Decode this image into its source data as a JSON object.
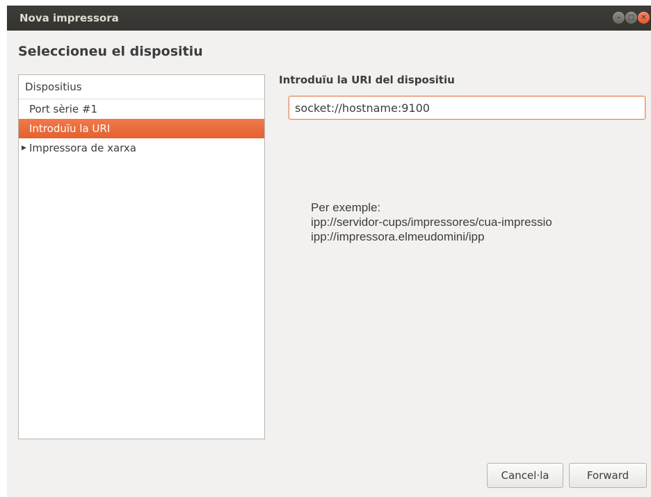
{
  "window": {
    "title": "Nova impressora"
  },
  "heading": "Seleccioneu el dispositiu",
  "devices": {
    "header": "Dispositius",
    "items": [
      {
        "label": "Port sèrie #1",
        "selected": false,
        "expandable": false
      },
      {
        "label": "Introduïu la URI",
        "selected": true,
        "expandable": false
      },
      {
        "label": "Impressora de xarxa",
        "selected": false,
        "expandable": true
      }
    ]
  },
  "uri": {
    "label": "Introduïu la URI del dispositiu",
    "value": "socket://hostname:9100"
  },
  "example": {
    "title": "Per exemple:",
    "line1": "ipp://servidor-cups/impressores/cua-impressio",
    "line2": "ipp://impressora.elmeudomini/ipp"
  },
  "buttons": {
    "cancel": "Cancel·la",
    "forward": "Forward"
  },
  "colors": {
    "selection": "#e96534",
    "titlebar": "#3a3935",
    "close_button": "#ec6a3e"
  },
  "icons": {
    "minimize": "minimize-icon",
    "maximize": "maximize-icon",
    "close": "close-icon",
    "expander": "triangle-right-icon"
  }
}
